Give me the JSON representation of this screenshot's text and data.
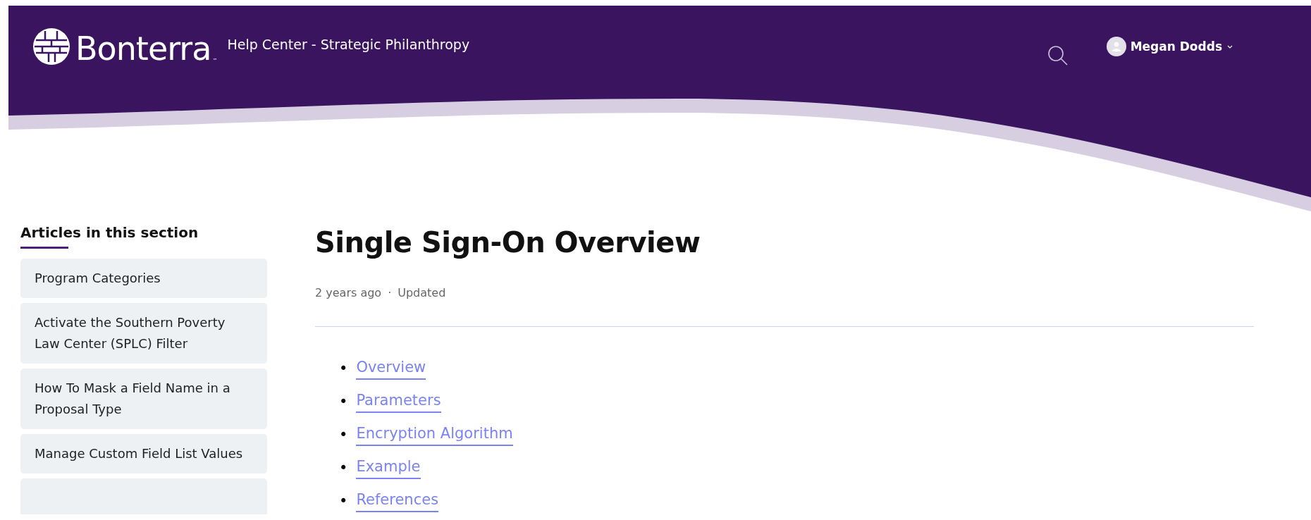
{
  "header": {
    "logo_text": "Bonterra",
    "trademark": "™",
    "subtitle": "Help Center - Strategic Philanthropy",
    "user_name": "Megan Dodds"
  },
  "sidebar": {
    "title": "Articles in this section",
    "items": [
      {
        "label": "Program Categories"
      },
      {
        "label": "Activate the Southern Poverty Law Center (SPLC) Filter"
      },
      {
        "label": "How To Mask a Field Name in a Proposal Type"
      },
      {
        "label": "Manage Custom Field List Values"
      }
    ],
    "more_below": true
  },
  "article": {
    "title": "Single Sign-On Overview",
    "age": "2 years ago",
    "separator": "·",
    "status": "Updated",
    "toc": [
      {
        "marker": "•",
        "label": "Overview"
      },
      {
        "marker": "•",
        "label": "Parameters"
      },
      {
        "marker": "•",
        "label": "Encryption Algorithm"
      },
      {
        "marker": "•",
        "label": "Example"
      },
      {
        "marker": "•",
        "label": "References"
      }
    ]
  }
}
